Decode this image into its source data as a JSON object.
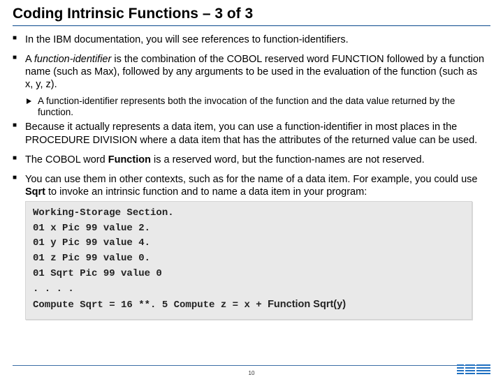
{
  "title": "Coding Intrinsic Functions – 3 of 3",
  "page_number": "10",
  "bullets": {
    "b1": "In the IBM documentation, you will see references to function-identifiers.",
    "b2_a": "A ",
    "b2_ital": "function-identifier",
    "b2_b": " is the combination of the COBOL reserved word FUNCTION followed by a function name (such as Max), followed by any arguments to be used in the evaluation of the function (such as x, y, z).",
    "b2_sub": "A function-identifier represents both the invocation of the function and the data value returned by the function.",
    "b3": "Because it actually represents a data item, you can use a function-identifier in most places in the PROCEDURE DIVISION where a data item that has the attributes of the returned value can be used.",
    "b4_a": "The COBOL word ",
    "b4_bold": "Function",
    "b4_b": " is a reserved word, but the function-names are not reserved.",
    "b5_a": "You can use them in other contexts, such as for the name of a data item. For example, you could use ",
    "b5_bold": "Sqrt",
    "b5_b": " to invoke an intrinsic function and to name a data item in your program:"
  },
  "code": {
    "l1": "Working-Storage Section.",
    "l2": "01 x Pic 99 value 2.",
    "l3": "01 y Pic 99 value 4.",
    "l4": "01 z Pic 99 value 0.",
    "l5": "01 Sqrt Pic 99 value 0",
    "l6": ". . . .",
    "l7a": "Compute Sqrt = 16 **. 5 Compute z = x + ",
    "l7b": "Function Sqrt(y)"
  },
  "logo_label": "IBM"
}
